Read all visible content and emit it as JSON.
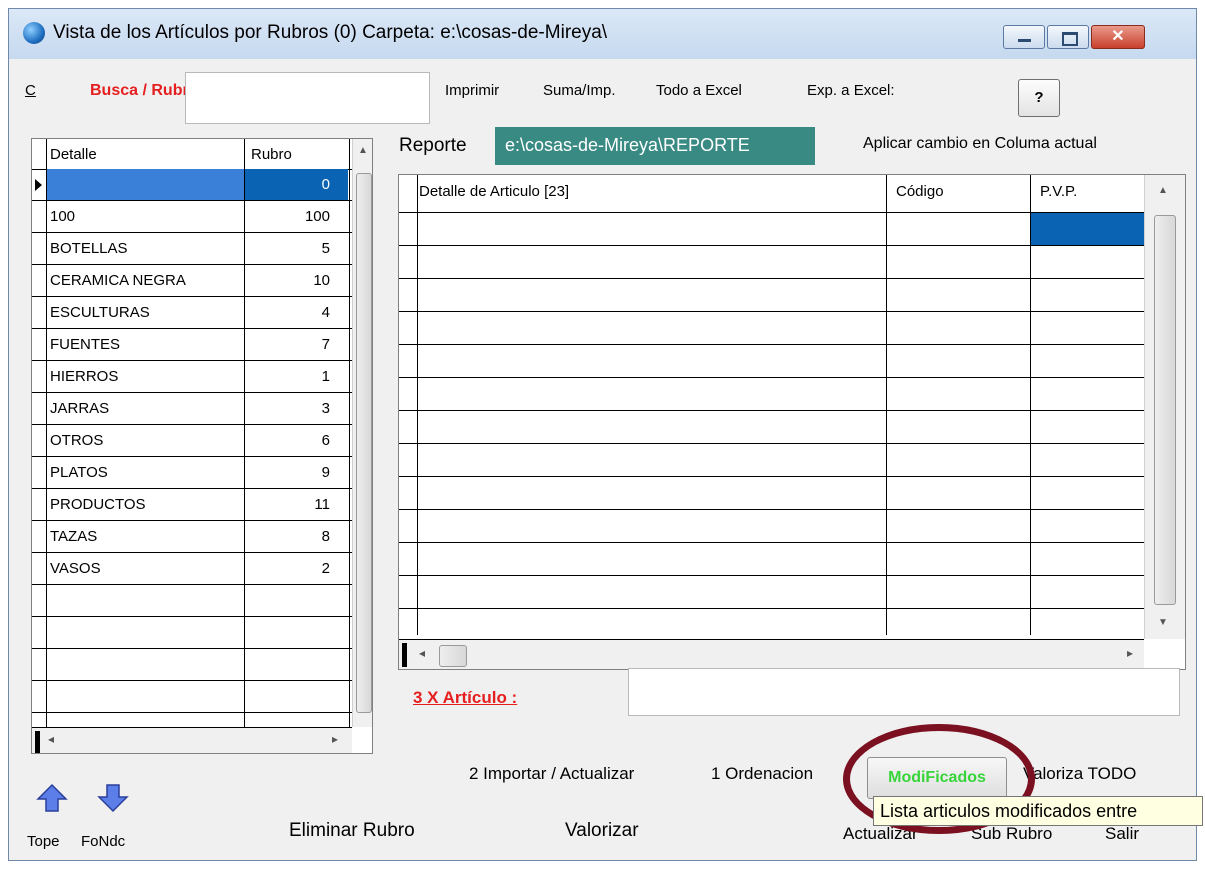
{
  "window": {
    "title": "Vista de los Artículos por Rubros (0) Carpeta: e:\\cosas-de-Mireya\\"
  },
  "toolbar": {
    "c_label": "C",
    "busca_label": "Busca / Rubros",
    "search_value": "",
    "imprimir": "Imprimir",
    "suma": "Suma/Imp.",
    "todo_excel": "Todo a Excel",
    "exp_excel": "Exp. a Excel:",
    "help": "?"
  },
  "rubros": {
    "headers": [
      "Detalle",
      "Rubro"
    ],
    "rows": [
      {
        "detalle": "",
        "rubro": "0"
      },
      {
        "detalle": "100",
        "rubro": "100"
      },
      {
        "detalle": "BOTELLAS",
        "rubro": "5"
      },
      {
        "detalle": "CERAMICA NEGRA",
        "rubro": "10"
      },
      {
        "detalle": "ESCULTURAS",
        "rubro": "4"
      },
      {
        "detalle": "FUENTES",
        "rubro": "7"
      },
      {
        "detalle": "HIERROS",
        "rubro": "1"
      },
      {
        "detalle": "JARRAS",
        "rubro": "3"
      },
      {
        "detalle": "OTROS",
        "rubro": "6"
      },
      {
        "detalle": "PLATOS",
        "rubro": "9"
      },
      {
        "detalle": "PRODUCTOS",
        "rubro": "11"
      },
      {
        "detalle": "TAZAS",
        "rubro": "8"
      },
      {
        "detalle": "VASOS",
        "rubro": "2"
      }
    ]
  },
  "reporte": {
    "label": "Reporte",
    "path": "e:\\cosas-de-Mireya\\REPORTE",
    "aplicar": "Aplicar cambio en Columa actual"
  },
  "articulos": {
    "headers": [
      "Detalle de Articulo [23]",
      "Código",
      "P.V.P."
    ]
  },
  "x_articulo": {
    "label": "3 X Artículo :",
    "value": ""
  },
  "buttons": {
    "importar": "2 Importar / Actualizar",
    "ordenacion": "1 Ordenacion",
    "modificados": "ModiFicados",
    "valoriza_todo": "Valoriza TODO",
    "eliminar_rubro": "Eliminar Rubro",
    "valorizar": "Valorizar",
    "actualizar": "Actualizar",
    "sub_rubro": "Sub Rubro",
    "salir": "Salir",
    "tope": "Tope",
    "fondo": "FoNdc"
  },
  "tooltip": "Lista articulos modificados entre"
}
